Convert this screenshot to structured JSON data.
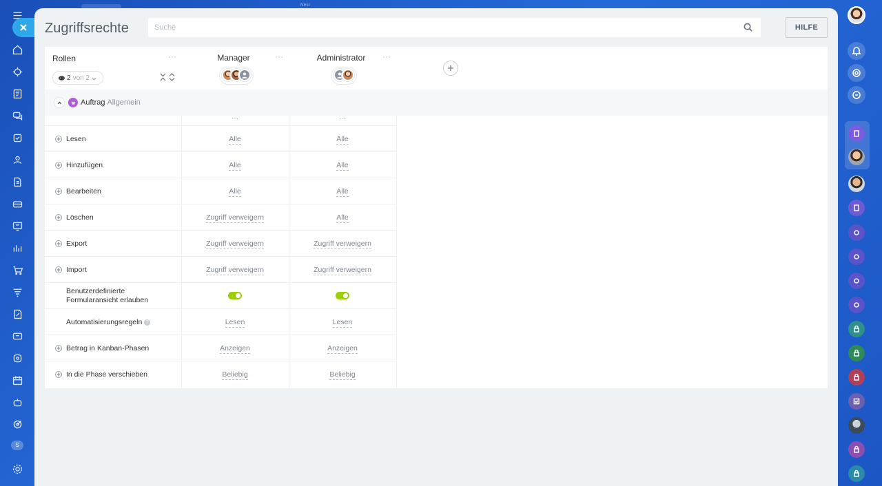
{
  "top_strip": {
    "neu_label": "NEU"
  },
  "page": {
    "title": "Zugriffsrechte",
    "search_placeholder": "Suche",
    "help_label": "HILFE"
  },
  "header": {
    "roles_label": "Rollen",
    "filter": {
      "count": "2",
      "of_text": "von 2"
    },
    "columns": [
      {
        "title": "Manager",
        "avatar_count": 3
      },
      {
        "title": "Administrator",
        "avatar_count": 2
      }
    ],
    "column_menu": "···"
  },
  "section": {
    "title": "Auftrag",
    "subtitle": "Allgemein"
  },
  "rows": [
    {
      "label": "Lesen",
      "expandable": true,
      "values": [
        "Alle",
        "Alle"
      ]
    },
    {
      "label": "Hinzufügen",
      "expandable": true,
      "values": [
        "Alle",
        "Alle"
      ]
    },
    {
      "label": "Bearbeiten",
      "expandable": true,
      "values": [
        "Alle",
        "Alle"
      ]
    },
    {
      "label": "Löschen",
      "expandable": true,
      "values": [
        "Zugriff verweigern",
        "Alle"
      ]
    },
    {
      "label": "Export",
      "expandable": true,
      "values": [
        "Zugriff verweigern",
        "Zugriff verweigern"
      ]
    },
    {
      "label": "Import",
      "expandable": true,
      "values": [
        "Zugriff verweigern",
        "Zugriff verweigern"
      ]
    },
    {
      "label_line1": "Benutzerdefinierte",
      "label_line2": "Formularansicht erlauben",
      "expandable": false,
      "toggles": [
        true,
        true
      ]
    },
    {
      "label": "Automatisierungsregeln",
      "expandable": false,
      "help": "?",
      "values": [
        "Lesen",
        "Lesen"
      ]
    },
    {
      "label": "Betrag in Kanban-Phasen",
      "expandable": true,
      "values": [
        "Anzeigen",
        "Anzeigen"
      ]
    },
    {
      "label": "In die Phase verschieben",
      "expandable": true,
      "values": [
        "Beliebig",
        "Beliebig"
      ]
    }
  ],
  "left_sidebar": {
    "icons": [
      "menu-icon",
      "close-icon",
      "home-icon",
      "puzzle-icon",
      "feed-icon",
      "chat-icon",
      "tasks-icon",
      "contacts-icon",
      "documents-icon",
      "crm-icon",
      "sites-icon",
      "analytics-icon",
      "shop-icon",
      "filter-icon",
      "sign-icon",
      "marketing-icon",
      "store-icon",
      "calendar-icon",
      "robot-icon",
      "goals-icon",
      "settings-icon"
    ],
    "badge": "S"
  },
  "colors": {
    "accent": "#2fa8ea",
    "toggle_on": "#9dcf00",
    "background": "#2569d8"
  }
}
